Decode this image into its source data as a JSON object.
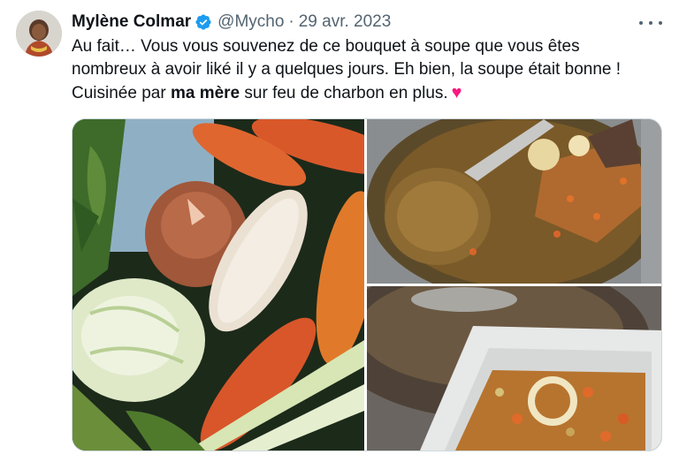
{
  "tweet": {
    "author_name": "Mylène Colmar",
    "handle": "@Mycho",
    "separator": "·",
    "date": "29 avr. 2023",
    "text_lines": {
      "line1": "Au fait… Vous vous souvenez de ce bouquet à soupe que vous êtes",
      "line2": "nombreux à avoir liké il y a quelques jours. Eh bien, la soupe était bonne !",
      "line3_pre": "Cuisinée par ",
      "line3_bold": "ma mère",
      "line3_post": " sur feu de charbon en plus.",
      "heart": "♥"
    }
  },
  "icons": {
    "verified": "verified-badge-icon",
    "more": "more-options-icon",
    "heart": "red-heart-emoji"
  },
  "colors": {
    "verified_blue": "#1d9bf0",
    "heart_red": "#e0245e",
    "secondary_text": "#536471"
  },
  "media": {
    "photos": [
      {
        "subject": "soup-vegetables-bouquet"
      },
      {
        "subject": "soup-pot-with-ladle"
      },
      {
        "subject": "soup-in-plastic-container"
      }
    ]
  }
}
